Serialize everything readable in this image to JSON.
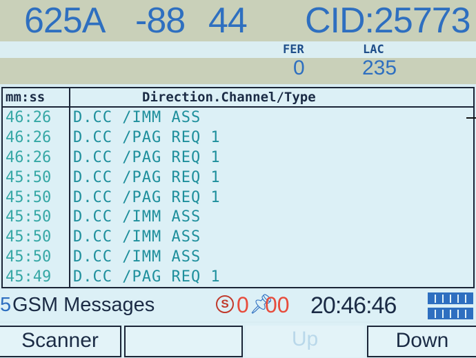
{
  "header": {
    "arfcn": "625A",
    "rxlev": "-88",
    "ta": "44",
    "cid": "CID:25773",
    "fer_label": "FER",
    "fer_value": "0",
    "lac_label": "LAC",
    "lac_value": "235"
  },
  "table": {
    "col_time": "mm:ss",
    "col_direction": "Direction.Channel/Type",
    "rows": [
      {
        "time": "46:26",
        "msg": "D.CC /IMM ASS"
      },
      {
        "time": "46:26",
        "msg": "D.CC /PAG REQ 1"
      },
      {
        "time": "46:26",
        "msg": "D.CC /PAG REQ 1"
      },
      {
        "time": "45:50",
        "msg": "D.CC /PAG REQ 1"
      },
      {
        "time": "45:50",
        "msg": "D.CC /PAG REQ 1"
      },
      {
        "time": "45:50",
        "msg": "D.CC /IMM ASS"
      },
      {
        "time": "45:50",
        "msg": "D.CC /IMM ASS"
      },
      {
        "time": "45:50",
        "msg": "D.CC /IMM ASS"
      },
      {
        "time": "45:49",
        "msg": "D.CC /PAG REQ 1"
      }
    ]
  },
  "status": {
    "count": "5",
    "label": "GSM Messages",
    "s_icon": "S",
    "rec_a": "0",
    "pin_icon": "pushpin-icon",
    "rec_b": "00",
    "clock": "20:46:46",
    "battery_icon": "battery-icon"
  },
  "softkeys": {
    "scanner": "Scanner",
    "blank": "",
    "up": "Up",
    "down": "Down"
  },
  "colors": {
    "header_band": "#c9d0b9",
    "accent_blue": "#2e6fc0",
    "row_text": "#1e8f9c",
    "screen_bg": "#d8ecf3",
    "record_red": "#e74c3c"
  }
}
